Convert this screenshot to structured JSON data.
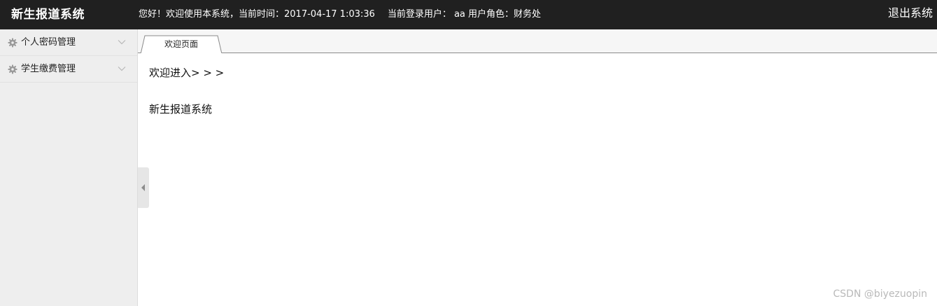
{
  "header": {
    "app_title": "新生报道系统",
    "welcome_text": "您好！欢迎使用本系统，当前时间：2017-04-17 1:03:36",
    "current_user_label": "当前登录用户：",
    "current_user": "aa",
    "role_text": "用户角色：财务处",
    "logout_label": "退出系统"
  },
  "sidebar": {
    "items": [
      {
        "label": "个人密码管理",
        "icon": "gear-icon"
      },
      {
        "label": "学生缴费管理",
        "icon": "gear-icon"
      }
    ]
  },
  "tabs": [
    {
      "label": "欢迎页面",
      "active": true
    }
  ],
  "content": {
    "greeting": "欢迎进入> > >",
    "system_name": "新生报道系统"
  },
  "watermark": "CSDN @biyezuopin",
  "colors": {
    "topbar_bg": "#202020",
    "sidebar_bg": "#eeeeee",
    "tab_border": "#8a8a8a"
  }
}
